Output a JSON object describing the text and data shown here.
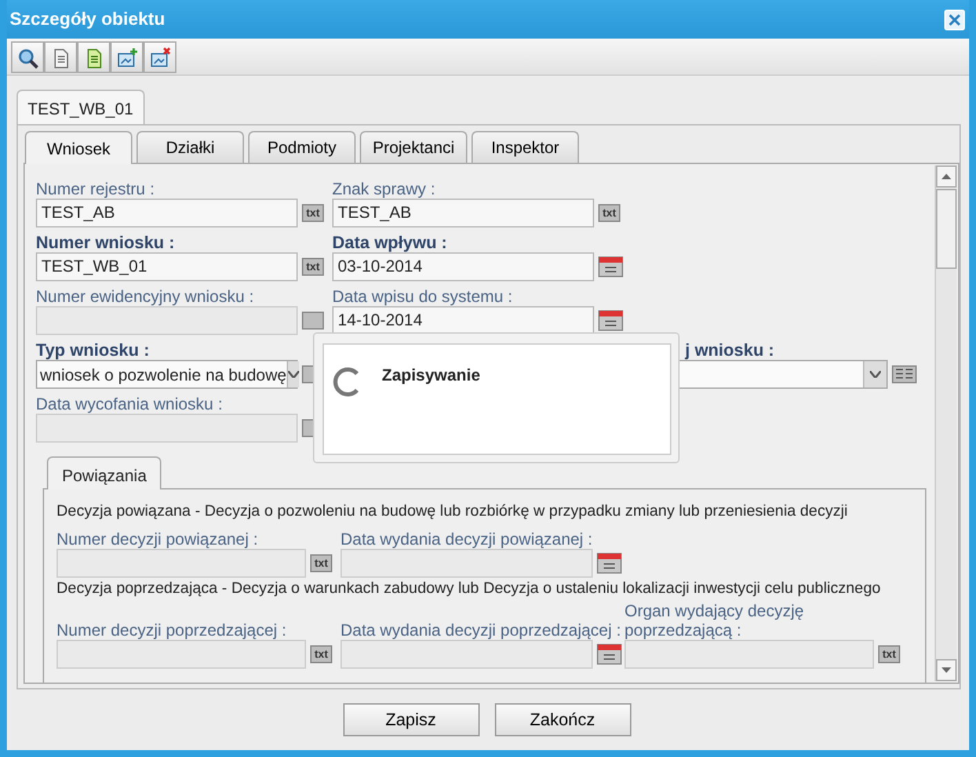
{
  "window": {
    "title": "Szczegóły obiektu"
  },
  "object_tab": {
    "label": "TEST_WB_01",
    "selected": true
  },
  "tabs": [
    {
      "label": "Wniosek",
      "selected": true
    },
    {
      "label": "Działki",
      "selected": false
    },
    {
      "label": "Podmioty",
      "selected": false
    },
    {
      "label": "Projektanci",
      "selected": false
    },
    {
      "label": "Inspektor",
      "selected": false
    }
  ],
  "form_rows": [
    [
      {
        "label": "Numer rejestru :",
        "value": "TEST_AB",
        "required": false,
        "kind": "text",
        "button_label": "txt"
      },
      {
        "label": "Znak sprawy :",
        "value": "TEST_AB",
        "required": false,
        "kind": "text",
        "button_label": "txt"
      }
    ],
    [
      {
        "label": "Numer wniosku :",
        "value": "TEST_WB_01",
        "required": true,
        "kind": "text",
        "button_label": "txt"
      },
      {
        "label": "Data wpływu :",
        "value": "03-10-2014",
        "required": true,
        "kind": "date"
      }
    ],
    [
      {
        "label": "Numer ewidencyjny wniosku :",
        "required": false,
        "kind": "text"
      },
      {
        "label": "Data wpisu do systemu :",
        "value": "14-10-2014",
        "required": false,
        "kind": "date"
      }
    ],
    [
      {
        "label": "Typ wniosku :",
        "value": "wniosek o pozwolenie na budowę",
        "required": true,
        "kind": "select"
      },
      {
        "label": "j wniosku :",
        "required": true,
        "kind": "wideselect"
      }
    ],
    [
      {
        "label": "Data wycofania wniosku :",
        "required": false,
        "kind": "text"
      }
    ]
  ],
  "section": {
    "tab_label": "Powiązania",
    "groups": [
      {
        "description": "Decyzja powiązana - Decyzja o pozwoleniu na budowę lub rozbiórkę w przypadku zmiany lub przeniesienia decyzji",
        "fields": [
          {
            "label": "Numer decyzji powiązanej :",
            "kind": "text",
            "button_label": "txt"
          },
          {
            "label": "Data wydania decyzji powiązanej :",
            "kind": "date"
          }
        ]
      },
      {
        "description": "Decyzja poprzedzająca - Decyzja o warunkach zabudowy lub Decyzja o ustaleniu lokalizacji inwestycji celu publicznego",
        "fields": [
          {
            "label": "Numer decyzji poprzedzającej :",
            "kind": "text",
            "button_label": "txt"
          },
          {
            "label": "Data wydania decyzji poprzedzającej :",
            "kind": "date"
          },
          {
            "label": "Organ wydający decyzję poprzedzającą :",
            "kind": "text",
            "button_label": "txt"
          }
        ]
      }
    ]
  },
  "dialog": {
    "message": "Zapisywanie"
  },
  "buttons": [
    "Zapisz",
    "Zakończ"
  ]
}
